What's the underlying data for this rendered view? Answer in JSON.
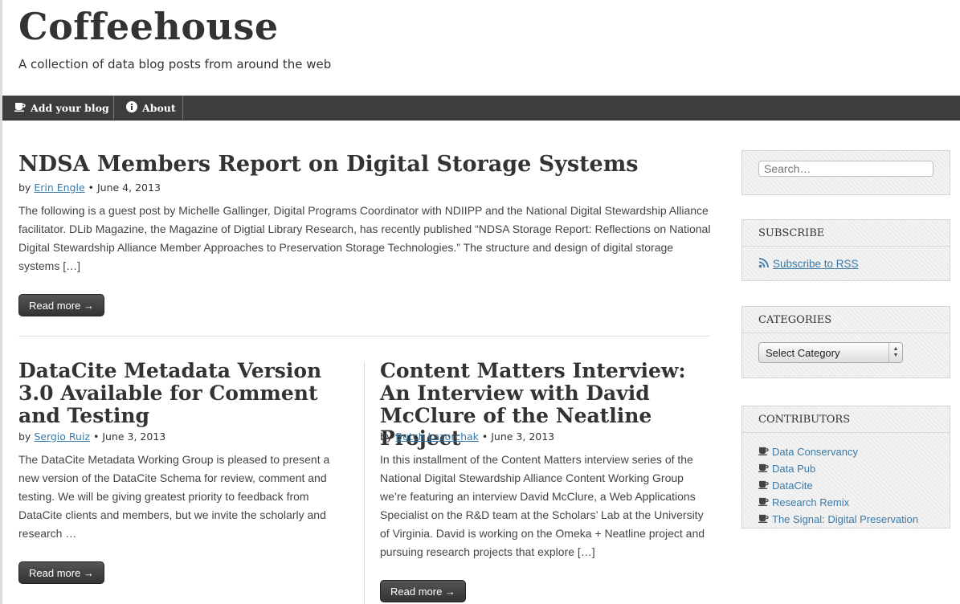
{
  "site": {
    "title": "Coffeehouse",
    "description": "A collection of data blog posts from around the web"
  },
  "nav": {
    "items": [
      {
        "label": "Add your blog",
        "icon": "coffee-cup-icon"
      },
      {
        "label": "About",
        "icon": "info-icon"
      }
    ]
  },
  "posts": [
    {
      "title": "NDSA Members Report on Digital Storage Systems",
      "by": "by",
      "author": "Erin Engle",
      "date": "June 4, 2013",
      "excerpt": "The following is a guest post by Michelle Gallinger, Digital Programs Coordinator with NDIIPP and the National Digital Stewardship Alliance facilitator. DLib Magazine, the Magazine of Digtial Library Research, has recently published “NDSA Storage Report: Reflections on National Digital Stewardship Alliance Member Approaches to Preservation Storage Technologies.” The structure and design of digital storage systems […]",
      "read_more": "Read more →"
    },
    {
      "title": "DataCite Metadata Version 3.0 Available for Comment and Testing",
      "by": "by",
      "author": "Sergio Ruiz",
      "date": "June 3, 2013",
      "excerpt": "The DataCite Metadata Working Group is pleased to present a new version of the DataCite Schema for review, comment and testing. We will be giving greatest priority to feedback from DataCite clients and members, but we invite the scholarly and research …",
      "read_more": "Read more →"
    },
    {
      "title": "Content Matters Interview: An Interview with David McClure of the Neatline Project",
      "by": "by",
      "author": "Butch Lazorchak",
      "date": "June 3, 2013",
      "excerpt": "In this installment of the Content Matters interview series of the National Digital Stewardship Alliance Content Working Group we’re featuring an interview David McClure, a Web Applications Specialist on the R&D team at the Scholars’ Lab at the University of Virginia. David is working on the Omeka + Neatline project and pursuing research projects that explore […]",
      "read_more": "Read more →"
    }
  ],
  "sidebar": {
    "search": {
      "placeholder": "Search…"
    },
    "subscribe": {
      "heading": "SUBSCRIBE",
      "link": "Subscribe to RSS"
    },
    "categories": {
      "heading": "CATEGORIES",
      "selected": "Select Category"
    },
    "contributors": {
      "heading": "CONTRIBUTORS",
      "items": [
        "Data Conservancy",
        "Data Pub",
        "DataCite",
        "Research Remix",
        "The Signal: Digital Preservation"
      ]
    }
  },
  "colors": {
    "navbar": "#3d3d3d",
    "link": "#3a7aa8",
    "button": "#3d3d3d"
  }
}
